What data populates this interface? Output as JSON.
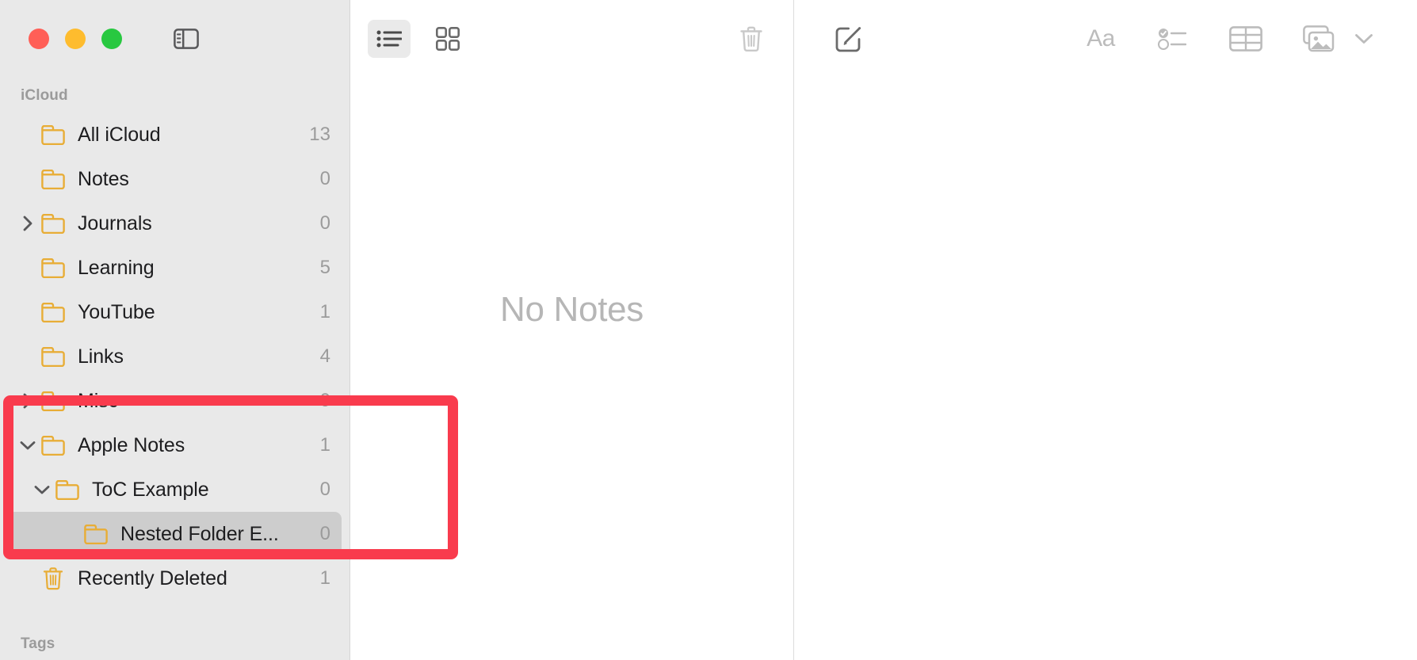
{
  "window": {
    "traffic_lights": [
      "close",
      "minimize",
      "maximize"
    ],
    "sidebar_toggle_label": "Toggle Sidebar"
  },
  "sidebar": {
    "sections": [
      {
        "header": "iCloud",
        "items": [
          {
            "label": "All iCloud",
            "count": "13",
            "icon": "folder-icon",
            "indent": 0,
            "twisty": "",
            "selected": false
          },
          {
            "label": "Notes",
            "count": "0",
            "icon": "folder-icon",
            "indent": 0,
            "twisty": "",
            "selected": false
          },
          {
            "label": "Journals",
            "count": "0",
            "icon": "folder-icon",
            "indent": 0,
            "twisty": "collapsed",
            "selected": false
          },
          {
            "label": "Learning",
            "count": "5",
            "icon": "folder-icon",
            "indent": 0,
            "twisty": "",
            "selected": false
          },
          {
            "label": "YouTube",
            "count": "1",
            "icon": "folder-icon",
            "indent": 0,
            "twisty": "",
            "selected": false
          },
          {
            "label": "Links",
            "count": "4",
            "icon": "folder-icon",
            "indent": 0,
            "twisty": "",
            "selected": false
          },
          {
            "label": "Misc",
            "count": "0",
            "icon": "folder-icon",
            "indent": 0,
            "twisty": "collapsed",
            "selected": false
          },
          {
            "label": "Apple Notes",
            "count": "1",
            "icon": "folder-icon",
            "indent": 0,
            "twisty": "expanded",
            "selected": false
          },
          {
            "label": "ToC Example",
            "count": "0",
            "icon": "folder-icon",
            "indent": 1,
            "twisty": "expanded",
            "selected": false
          },
          {
            "label": "Nested Folder E...",
            "count": "0",
            "icon": "folder-icon",
            "indent": 2,
            "twisty": "",
            "selected": true
          },
          {
            "label": "Recently Deleted",
            "count": "1",
            "icon": "trash-icon",
            "indent": 0,
            "twisty": "",
            "selected": false
          }
        ]
      },
      {
        "header": "Tags",
        "items": []
      }
    ]
  },
  "notelist": {
    "toolbar": {
      "list_view_label": "List View",
      "gallery_view_label": "Gallery View",
      "delete_label": "Delete Note",
      "active_view": "list"
    },
    "empty_state": "No Notes"
  },
  "editor": {
    "toolbar": {
      "compose_label": "New Note",
      "format_label": "Aa",
      "checklist_label": "Checklist",
      "table_label": "Table",
      "media_label": "Media",
      "media_menu_label": "Media Options"
    }
  },
  "annotation": {
    "color": "#f93b4d",
    "target": "Apple Notes / ToC Example / Nested Folder E..."
  },
  "colors": {
    "sidebar_bg": "#e9e9e9",
    "folder_icon": "#e8ad36",
    "selected_row": "#cdcdcd",
    "muted_text": "#9b9b9b",
    "accent_red": "#f93b4d"
  }
}
